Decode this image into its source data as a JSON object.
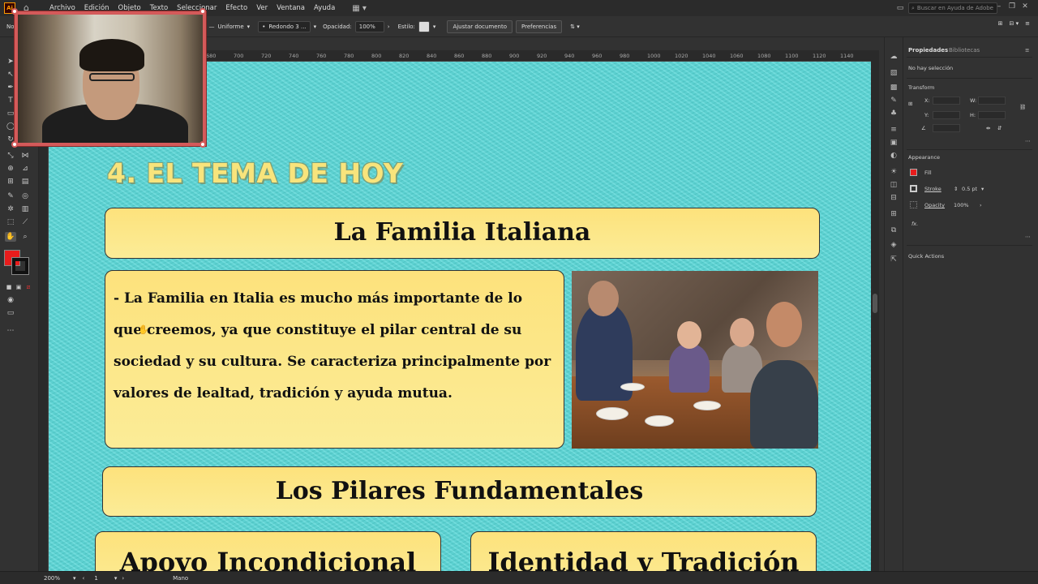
{
  "app": {
    "logo": "Ai",
    "menu": [
      "Archivo",
      "Edición",
      "Objeto",
      "Texto",
      "Seleccionar",
      "Efecto",
      "Ver",
      "Ventana",
      "Ayuda"
    ],
    "search_placeholder": "Buscar en Ayuda de Adobe"
  },
  "controlbar": {
    "left_label": "No",
    "stroke_profile": "Uniforme",
    "brush": "Redondo 3 ...",
    "opacity_label": "Opacidad:",
    "opacity_value": "100%",
    "style_label": "Estilo:",
    "fit_document": "Ajustar documento",
    "preferences": "Preferencias"
  },
  "ruler": {
    "ticks": [
      "680",
      "700",
      "720",
      "740",
      "760",
      "780",
      "800",
      "820",
      "840",
      "860",
      "880",
      "900",
      "920",
      "940",
      "960",
      "980",
      "1000",
      "1020",
      "1040",
      "1060",
      "1080",
      "1100",
      "1120",
      "1140"
    ]
  },
  "artboard": {
    "section_title": "4. EL TEMA DE HOY",
    "heading1": "La Familia Italiana",
    "paragraph": "- La Familia en Italia es mucho más importante de lo que creemos, ya que constituye el pilar central de su sociedad y su cultura. Se caracteriza principalmente por valores de lealtad, tradición y ayuda mutua.",
    "heading2": "Los Pilares Fundamentales",
    "card_left": "Apoyo Incondicional",
    "card_right": "Identidad y Tradición",
    "colors": {
      "background": "#56d6d6",
      "box_fill": "#fde27c",
      "title_fill": "#f8e47c"
    }
  },
  "properties": {
    "tab_properties": "Propiedades",
    "tab_libraries": "Bibliotecas",
    "no_selection": "No hay selección",
    "transform": "Transform",
    "x_label": "X:",
    "y_label": "Y:",
    "w_label": "W:",
    "h_label": "H:",
    "appearance": "Appearance",
    "fill": "Fill",
    "stroke": "Stroke",
    "stroke_value": "0.5 pt",
    "opacity": "Opacity",
    "opacity_value": "100%",
    "fx": "fx.",
    "quick_actions": "Quick Actions"
  },
  "status": {
    "zoom": "200%",
    "artboard_num": "1",
    "tool": "Mano"
  },
  "toolbar": {
    "fill_color": "#e81c1c",
    "stroke_color": "#111111"
  }
}
